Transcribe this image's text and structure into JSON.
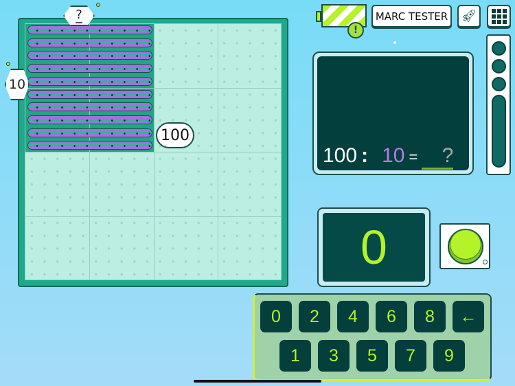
{
  "board": {
    "column_label": "?",
    "row_label": "10",
    "rod_count": 10,
    "product_bubble": "100"
  },
  "header": {
    "user_name": "MARC TESTER",
    "battery_alert": "!",
    "rocket_icon": "rocket-icon",
    "menu_icon": "grid-icon"
  },
  "equation": {
    "dividend": "100",
    "operator": ":",
    "divisor": "10",
    "equals": "=",
    "answer": "?"
  },
  "display": {
    "value": "0"
  },
  "keypad": {
    "row1": [
      "0",
      "2",
      "4",
      "6",
      "8",
      "←"
    ],
    "row2": [
      "1",
      "3",
      "5",
      "7",
      "9"
    ]
  },
  "colors": {
    "accent": "#b4f22a",
    "divisor": "#b57be8",
    "board": "#1fa88a",
    "rod": "#a46fe0"
  }
}
